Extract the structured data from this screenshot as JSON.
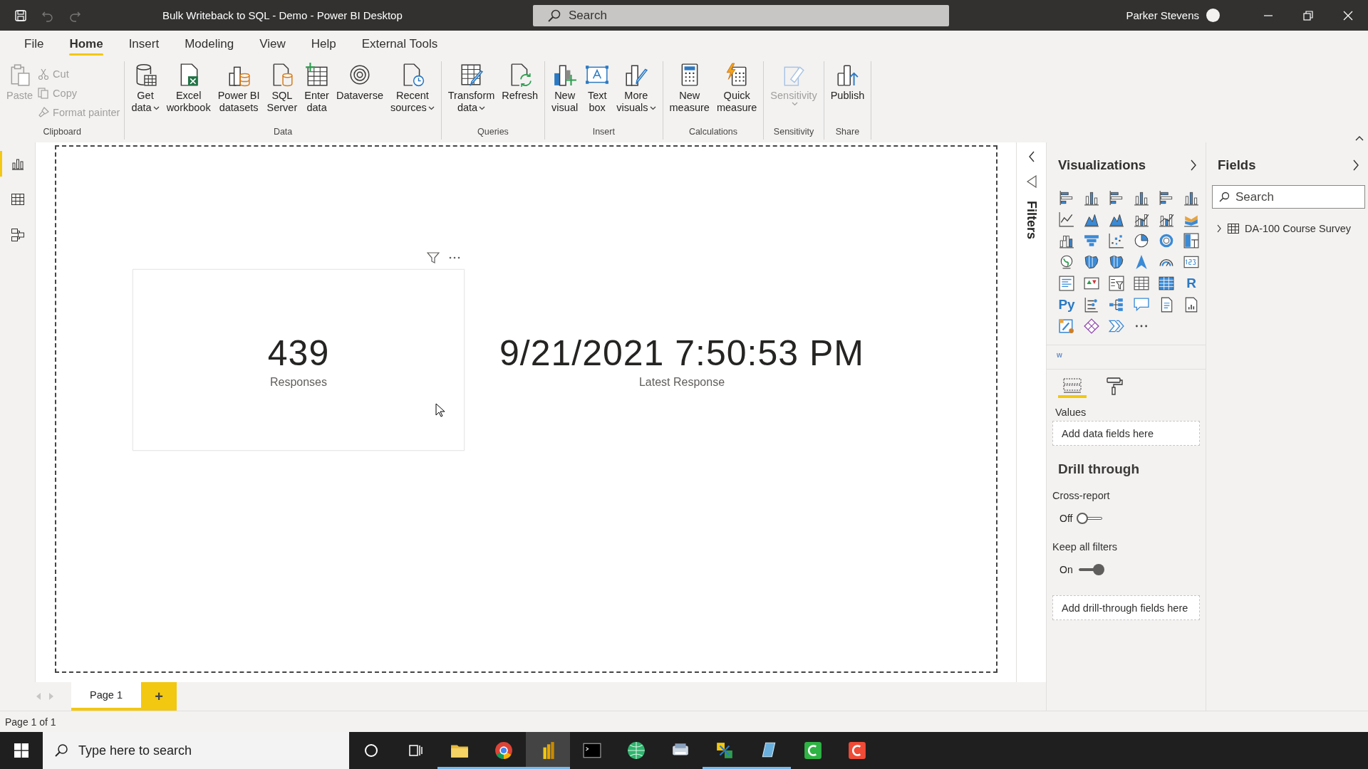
{
  "title_bar": {
    "title": "Bulk Writeback to SQL - Demo - Power BI Desktop",
    "search": {
      "placeholder": "Search"
    },
    "user": "Parker Stevens",
    "quick_access": [
      {
        "disabled": false
      },
      {
        "disabled": true
      },
      {
        "disabled": true
      }
    ]
  },
  "menu_tabs": [
    {
      "label": "File",
      "selected": false
    },
    {
      "label": "Home",
      "selected": true
    },
    {
      "label": "Insert",
      "selected": false
    },
    {
      "label": "Modeling",
      "selected": false
    },
    {
      "label": "View",
      "selected": false
    },
    {
      "label": "Help",
      "selected": false
    },
    {
      "label": "External Tools",
      "selected": false
    }
  ],
  "ribbon": {
    "groups": [
      {
        "label": "Clipboard",
        "buttons": [
          {
            "kind": "large",
            "label": "Paste",
            "disabled": true
          },
          {
            "kind": "small",
            "label": "Cut",
            "disabled": true
          },
          {
            "kind": "small",
            "label": "Copy",
            "disabled": true
          },
          {
            "kind": "small",
            "label": "Format painter",
            "disabled": true
          }
        ]
      },
      {
        "label": "Data",
        "buttons": [
          {
            "kind": "large",
            "label": "Get\ndata",
            "disabled": false,
            "dropdown": true
          },
          {
            "kind": "large",
            "label": "Excel\nworkbook",
            "disabled": false
          },
          {
            "kind": "large",
            "label": "Power BI\ndatasets",
            "disabled": false
          },
          {
            "kind": "large",
            "label": "SQL\nServer",
            "disabled": false
          },
          {
            "kind": "large",
            "label": "Enter\ndata",
            "disabled": false
          },
          {
            "kind": "large",
            "label": "Dataverse",
            "disabled": false
          },
          {
            "kind": "large",
            "label": "Recent\nsources",
            "disabled": false,
            "dropdown": true
          }
        ]
      },
      {
        "label": "Queries",
        "buttons": [
          {
            "kind": "large",
            "label": "Transform\ndata",
            "disabled": false,
            "dropdown": true
          },
          {
            "kind": "large",
            "label": "Refresh",
            "disabled": false
          }
        ]
      },
      {
        "label": "Insert",
        "buttons": [
          {
            "kind": "large",
            "label": "New\nvisual",
            "disabled": false
          },
          {
            "kind": "large",
            "label": "Text\nbox",
            "disabled": false
          },
          {
            "kind": "large",
            "label": "More\nvisuals",
            "disabled": false,
            "dropdown": true
          }
        ]
      },
      {
        "label": "Calculations",
        "buttons": [
          {
            "kind": "large",
            "label": "New\nmeasure",
            "disabled": false
          },
          {
            "kind": "large",
            "label": "Quick\nmeasure",
            "disabled": false
          }
        ]
      },
      {
        "label": "Sensitivity",
        "buttons": [
          {
            "kind": "large",
            "label": "Sensitivity",
            "disabled": true,
            "dropdown": true
          }
        ]
      },
      {
        "label": "Share",
        "buttons": [
          {
            "kind": "large",
            "label": "Publish",
            "disabled": false
          }
        ]
      }
    ]
  },
  "left_nav": [
    {
      "selected": true
    },
    {
      "selected": false
    },
    {
      "selected": false
    }
  ],
  "canvas": {
    "visuals": [
      {
        "value": "439",
        "label": "Responses",
        "selected": true
      },
      {
        "value": "9/21/2021 7:50:53 PM",
        "label": "Latest Response",
        "selected": false
      }
    ]
  },
  "filters_pane": {
    "title": "Filters"
  },
  "visualizations": {
    "title": "Visualizations",
    "gallery": [
      {
        "kind": "hbar"
      },
      {
        "kind": "vbar"
      },
      {
        "kind": "hbar"
      },
      {
        "kind": "vbar"
      },
      {
        "kind": "hbar"
      },
      {
        "kind": "vbar"
      },
      {
        "kind": "line"
      },
      {
        "kind": "area"
      },
      {
        "kind": "area"
      },
      {
        "kind": "combo"
      },
      {
        "kind": "combo"
      },
      {
        "kind": "ribbon"
      },
      {
        "kind": "waterfall"
      },
      {
        "kind": "funnel"
      },
      {
        "kind": "scatter"
      },
      {
        "kind": "pie"
      },
      {
        "kind": "donut"
      },
      {
        "kind": "treemap"
      },
      {
        "kind": "globe"
      },
      {
        "kind": "map"
      },
      {
        "kind": "map"
      },
      {
        "kind": "navigation"
      },
      {
        "kind": "gauge"
      },
      {
        "kind": "card"
      },
      {
        "kind": "list"
      },
      {
        "kind": "kpi"
      },
      {
        "kind": "slicer"
      },
      {
        "kind": "table"
      },
      {
        "kind": "matrix"
      },
      {
        "kind": "text",
        "glyph": "R"
      },
      {
        "kind": "text",
        "glyph": "Py"
      },
      {
        "kind": "influencers"
      },
      {
        "kind": "tree"
      },
      {
        "kind": "speech"
      },
      {
        "kind": "narrative"
      },
      {
        "kind": "report"
      },
      {
        "kind": "apps"
      },
      {
        "kind": "diamond"
      },
      {
        "kind": "chevron"
      },
      {
        "kind": "more"
      }
    ],
    "custom_label": "w",
    "build_tabs": [
      {
        "selected": true
      },
      {
        "selected": false
      }
    ],
    "values_label": "Values",
    "values_placeholder": "Add data fields here",
    "drill_through": {
      "title": "Drill through",
      "toggles": [
        {
          "label": "Cross-report",
          "state_label": "Off",
          "on": false
        },
        {
          "label": "Keep all filters",
          "state_label": "On",
          "on": true
        }
      ],
      "placeholder": "Add drill-through fields here"
    }
  },
  "fields": {
    "title": "Fields",
    "search": {
      "placeholder": "Search"
    },
    "tables": [
      {
        "label": "DA-100 Course Survey",
        "expanded": false
      }
    ]
  },
  "page_tabs": [
    {
      "label": "Page 1",
      "selected": true
    }
  ],
  "add_page": "+",
  "status_bar": "Page 1 of 1",
  "taskbar": {
    "search": {
      "placeholder": "Type here to search"
    },
    "apps": [
      {
        "running": true,
        "selected": false
      },
      {
        "running": true,
        "selected": false
      },
      {
        "running": true,
        "selected": true
      },
      {
        "running": false,
        "selected": false
      },
      {
        "running": false,
        "selected": false
      },
      {
        "running": false,
        "selected": false
      },
      {
        "running": true,
        "selected": false
      },
      {
        "running": true,
        "selected": false
      },
      {
        "running": false,
        "selected": false
      },
      {
        "running": false,
        "selected": false
      }
    ]
  }
}
